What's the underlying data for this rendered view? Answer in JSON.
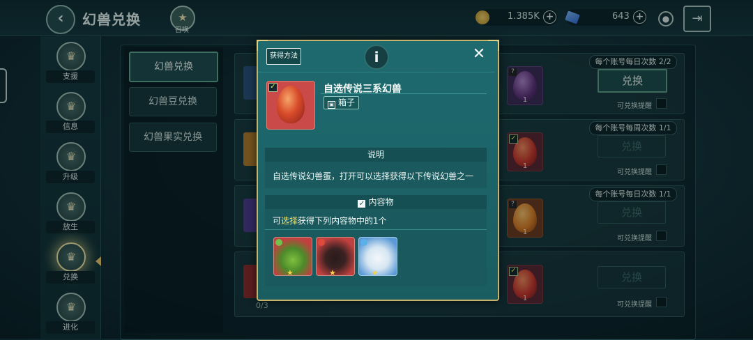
{
  "header": {
    "title": "幻兽兑换",
    "back_icon": "back-arrow-icon",
    "summon_label": "召唤",
    "gold": "1.385K",
    "diamonds": "643"
  },
  "nav": [
    {
      "label": "支援",
      "icon": "badge-icon"
    },
    {
      "label": "信息",
      "icon": "badge-icon"
    },
    {
      "label": "升级",
      "icon": "badge-icon"
    },
    {
      "label": "放生",
      "icon": "badge-icon"
    },
    {
      "label": "兑换",
      "icon": "badge-icon",
      "active": true
    },
    {
      "label": "进化",
      "icon": "badge-icon"
    }
  ],
  "categories": [
    {
      "label": "幻兽兑换",
      "active": true
    },
    {
      "label": "幻兽豆兑换"
    },
    {
      "label": "幻兽果实兑换"
    }
  ],
  "rows": [
    {
      "limit": "每个账号每日次数 2/2",
      "button": "兑换",
      "enabled": true,
      "remind": "可兑换提醒",
      "result_count": "1",
      "egg_color": "purple",
      "marker": "?"
    },
    {
      "limit": "每个账号每周次数 1/1",
      "button": "兑换",
      "enabled": false,
      "remind": "可兑换提醒",
      "result_count": "1",
      "egg_color": "red",
      "marker": "check"
    },
    {
      "limit": "每个账号每日次数 1/1",
      "button": "兑换",
      "enabled": false,
      "remind": "可兑换提醒",
      "result_count": "1",
      "egg_color": "orange",
      "marker": "?"
    },
    {
      "limit": "",
      "button": "兑换",
      "enabled": false,
      "remind": "可兑换提醒",
      "result_count": "1",
      "egg_color": "red",
      "marker": "check",
      "progress": "0/3"
    }
  ],
  "modal": {
    "how_to_get": "获得方法",
    "info_icon": "info-icon",
    "close_icon": "close-icon",
    "item_name": "自选传说三系幻兽",
    "item_type": "箱子",
    "desc_header": "说明",
    "description": "自选传说幻兽蛋，打开可以选择获得以下传说幻兽之一",
    "contents_header": "内容物",
    "choose_prefix": "可",
    "choose_highlight": "选择",
    "choose_suffix": "获得下列内容物中的1个",
    "pets": [
      {
        "name": "green-beast",
        "color": "#d94a4a",
        "badge": "#6fc24a"
      },
      {
        "name": "black-cat",
        "color": "#d94a4a",
        "badge": "#e04a3a"
      },
      {
        "name": "white-beast",
        "color": "#8ec6ea",
        "badge": "#5ab0e8"
      }
    ]
  }
}
